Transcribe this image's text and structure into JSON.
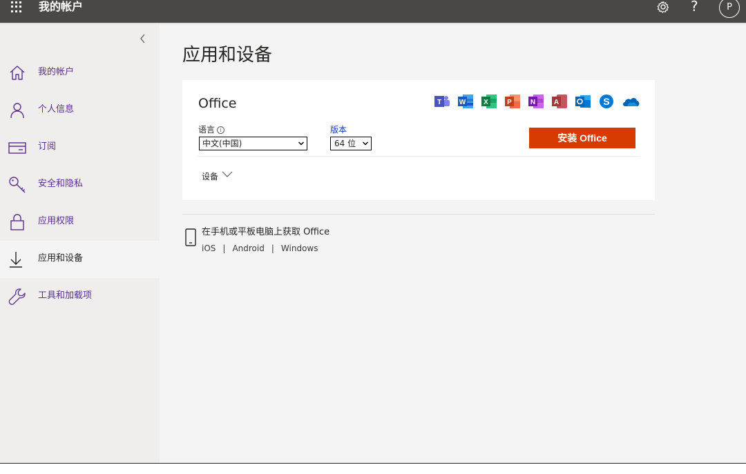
{
  "header": {
    "app_title": "我的帐户",
    "waffle_icon": "waffle-icon",
    "settings_icon": "gear-icon",
    "help_label": "?",
    "avatar_initial": "P"
  },
  "sidebar": {
    "collapse_icon": "chevron-left-icon",
    "items": [
      {
        "label": "我的帐户",
        "icon": "home-icon",
        "active": false
      },
      {
        "label": "个人信息",
        "icon": "person-icon",
        "active": false
      },
      {
        "label": "订阅",
        "icon": "card-icon",
        "active": false
      },
      {
        "label": "安全和隐私",
        "icon": "key-icon",
        "active": false
      },
      {
        "label": "应用权限",
        "icon": "lock-icon",
        "active": false
      },
      {
        "label": "应用和设备",
        "icon": "download-icon",
        "active": true
      },
      {
        "label": "工具和加载项",
        "icon": "wrench-icon",
        "active": false
      }
    ]
  },
  "main": {
    "page_title": "应用和设备",
    "office_card": {
      "title": "Office",
      "app_icons": [
        "teams-icon",
        "word-icon",
        "excel-icon",
        "powerpoint-icon",
        "onenote-icon",
        "access-icon",
        "outlook-icon",
        "skype-icon",
        "onedrive-icon"
      ],
      "language_label": "语言",
      "language_value": "中文(中国)",
      "version_label": "版本",
      "version_value": "64 位",
      "install_button": "安装 Office",
      "devices_label": "设备"
    },
    "mobile": {
      "title": "在手机或平板电脑上获取 Office",
      "links": [
        "iOS",
        "Android",
        "Windows"
      ],
      "separator": "|"
    }
  },
  "colors": {
    "topbar": "#4a4845",
    "nav_link": "#5c2d91",
    "install_button": "#d83b01",
    "version_label": "#0b3bb7"
  }
}
